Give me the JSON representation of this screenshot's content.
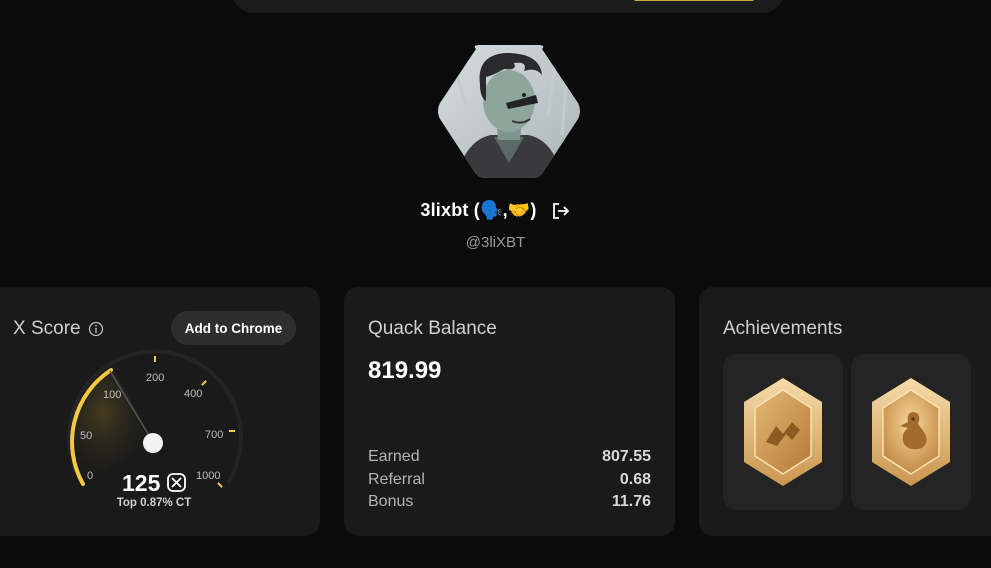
{
  "profile": {
    "name": "3lixbt (🗣️,🤝)",
    "handle": "@3liXBT"
  },
  "xscore": {
    "title": "X Score",
    "add_button": "Add to Chrome",
    "score": "125",
    "rank": "Top 0.87% CT",
    "ticks": [
      "0",
      "50",
      "100",
      "200",
      "400",
      "700",
      "1000"
    ],
    "gauge_fill_fraction": 0.22,
    "accent": "#f5c842"
  },
  "quack": {
    "title": "Quack Balance",
    "balance": "819.99",
    "rows": [
      {
        "label": "Earned",
        "value": "807.55"
      },
      {
        "label": "Referral",
        "value": "0.68"
      },
      {
        "label": "Bonus",
        "value": "11.76"
      }
    ]
  },
  "achievements": {
    "title": "Achievements",
    "badges": [
      "zigzag-badge-icon",
      "duck-badge-icon"
    ]
  }
}
